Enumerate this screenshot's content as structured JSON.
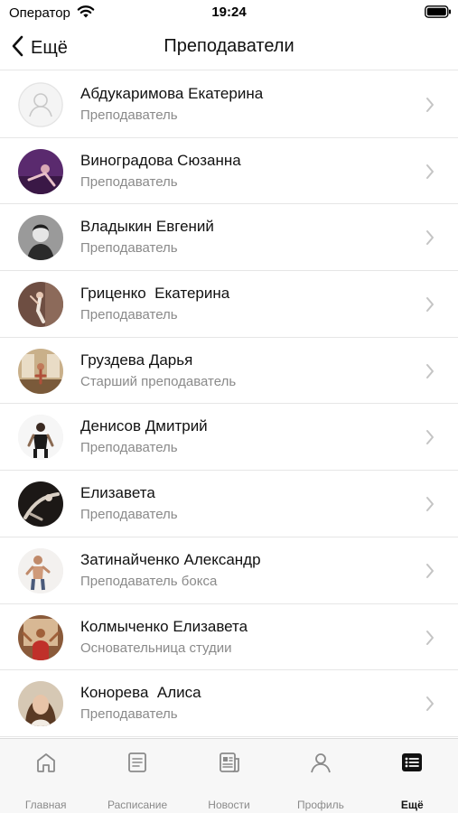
{
  "status_bar": {
    "carrier": "Оператор",
    "time": "19:24"
  },
  "nav": {
    "back_label": "Ещё",
    "title": "Преподаватели"
  },
  "teachers": [
    {
      "name": "Абдукаримова Екатерина",
      "role": "Преподаватель",
      "avatar": "placeholder-person-icon"
    },
    {
      "name": "Виноградова Сюзанна",
      "role": "Преподаватель",
      "avatar": "photo-violet"
    },
    {
      "name": "Владыкин Евгений",
      "role": "Преподаватель",
      "avatar": "photo-bw"
    },
    {
      "name": "Гриценко  Екатерина",
      "role": "Преподаватель",
      "avatar": "photo-brown"
    },
    {
      "name": "Груздева Дарья",
      "role": "Старший преподаватель",
      "avatar": "photo-studio"
    },
    {
      "name": "Денисов Дмитрий",
      "role": "Преподаватель",
      "avatar": "photo-white-bg"
    },
    {
      "name": "Елизавета",
      "role": "Преподаватель",
      "avatar": "photo-dark"
    },
    {
      "name": "Затинайченко Александр",
      "role": "Преподаватель бокса",
      "avatar": "photo-light"
    },
    {
      "name": "Колмыченко Елизавета",
      "role": "Основательница студии",
      "avatar": "photo-warm"
    },
    {
      "name": "Конорева  Алиса",
      "role": "Преподаватель",
      "avatar": "photo-portrait"
    }
  ],
  "tab_bar": {
    "tabs": [
      {
        "label": "Главная",
        "icon": "home-icon",
        "active": false
      },
      {
        "label": "Расписание",
        "icon": "schedule-icon",
        "active": false
      },
      {
        "label": "Новости",
        "icon": "news-icon",
        "active": false
      },
      {
        "label": "Профиль",
        "icon": "profile-icon",
        "active": false
      },
      {
        "label": "Ещё",
        "icon": "more-list-icon",
        "active": true
      }
    ]
  },
  "colors": {
    "text": "#111111",
    "secondary_text": "#8a8a8a",
    "separator": "#e6e6e6",
    "chevron": "#c4c4c4",
    "tab_bar_bg": "#f7f7f7"
  }
}
